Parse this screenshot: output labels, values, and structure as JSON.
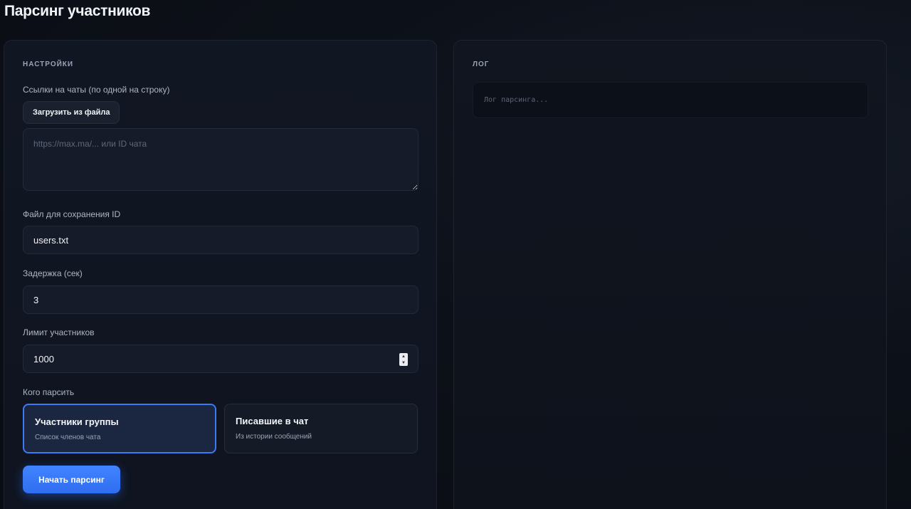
{
  "page": {
    "title": "Парсинг участников"
  },
  "settings": {
    "section_title": "НАСТРОЙКИ",
    "links_label": "Ссылки на чаты (по одной на строку)",
    "load_file_button": "Загрузить из файла",
    "links_placeholder": "https://max.ma/... или ID чата",
    "links_value": "",
    "file_label": "Файл для сохранения ID",
    "file_value": "users.txt",
    "delay_label": "Задержка (сек)",
    "delay_value": "3",
    "limit_label": "Лимит участников",
    "limit_value": "1000",
    "target_label": "Кого парсить",
    "targets": [
      {
        "title": "Участники группы",
        "subtitle": "Список членов чата",
        "selected": true
      },
      {
        "title": "Писавшие в чат",
        "subtitle": "Из истории сообщений",
        "selected": false
      }
    ],
    "start_button": "Начать парсинг"
  },
  "log": {
    "section_title": "ЛОГ",
    "placeholder": "Лог парсинга..."
  },
  "colors": {
    "accent": "#3a7af5",
    "background": "#0b0e15",
    "panel": "#111623"
  }
}
